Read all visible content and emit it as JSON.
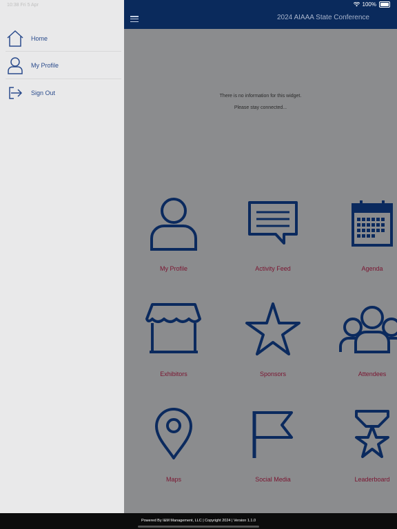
{
  "status": {
    "time": "10:38",
    "date": "Fri 5 Apr",
    "battery": "100%"
  },
  "header": {
    "title": "2024 AIAAA State Conference"
  },
  "sidebar": {
    "items": [
      {
        "label": "Home",
        "icon": "home-icon"
      },
      {
        "label": "My Profile",
        "icon": "user-icon"
      },
      {
        "label": "Sign Out",
        "icon": "sign-out-icon"
      }
    ]
  },
  "widget": {
    "message1": "There is no information for this widget.",
    "message2": "Please stay connected..."
  },
  "tiles": [
    {
      "label": "My Profile",
      "icon": "user-icon"
    },
    {
      "label": "Activity Feed",
      "icon": "chat-icon"
    },
    {
      "label": "Agenda",
      "icon": "calendar-icon"
    },
    {
      "label": "Exhibitors",
      "icon": "booth-icon"
    },
    {
      "label": "Sponsors",
      "icon": "star-icon"
    },
    {
      "label": "Attendees",
      "icon": "group-icon"
    },
    {
      "label": "Maps",
      "icon": "map-pin-icon"
    },
    {
      "label": "Social Media",
      "icon": "flag-icon"
    },
    {
      "label": "Leaderboard",
      "icon": "trophy-icon"
    }
  ],
  "footer": {
    "text": "Powered By I&M Management, LLC | Copyright 2024 | Version 1.1.0"
  },
  "colors": {
    "header": "#0a2a5c",
    "icon": "#0b2a5e",
    "tile_label": "#7a1430",
    "sidebar_text": "#2a4b8c"
  }
}
